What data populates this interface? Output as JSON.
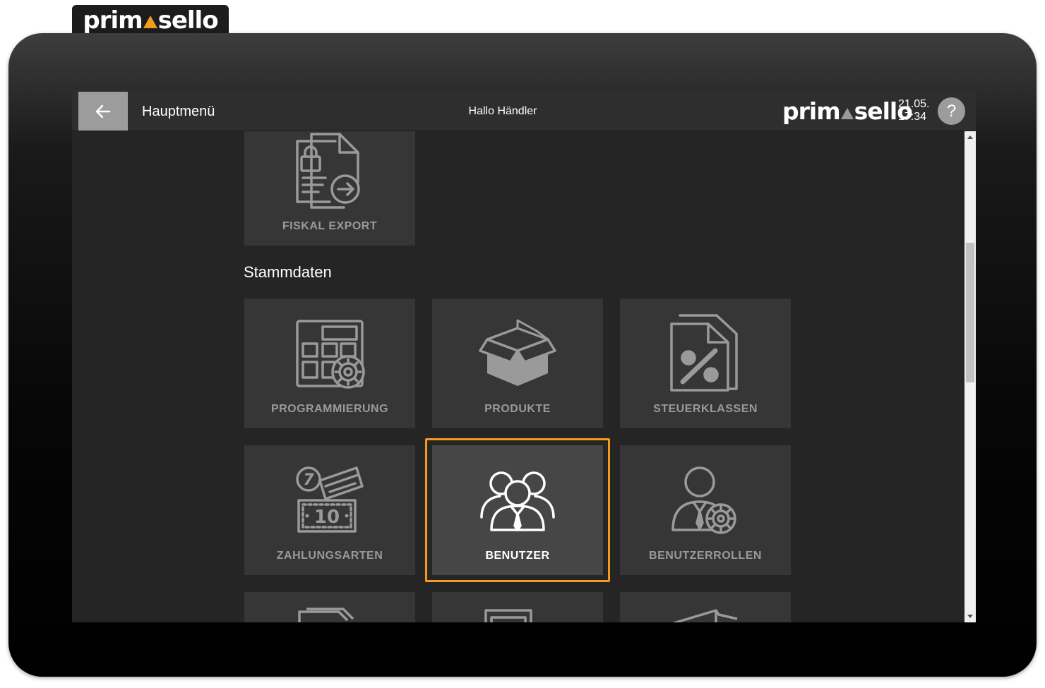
{
  "brand": {
    "name_left": "prim",
    "name_right": "sello"
  },
  "header": {
    "title": "Hauptmenü",
    "greeting": "Hallo Händler",
    "date": "21.05.",
    "time": "17:34",
    "help_label": "?"
  },
  "sections": {
    "stammdaten_title": "Stammdaten"
  },
  "tiles": {
    "fiskal_export": "FISKAL EXPORT",
    "programmierung": "PROGRAMMIERUNG",
    "produkte": "PRODUKTE",
    "steuerklassen": "STEUERKLASSEN",
    "zahlungsarten": "ZAHLUNGSARTEN",
    "benutzer": "BENUTZER",
    "benutzerrollen": "BENUTZERROLLEN",
    "zahlungsarten_coin": "7",
    "zahlungsarten_note": "10"
  },
  "colors": {
    "accent": "#f39b1d",
    "tile": "#363636",
    "tile_active": "#464646",
    "screen_bg": "#252525"
  }
}
